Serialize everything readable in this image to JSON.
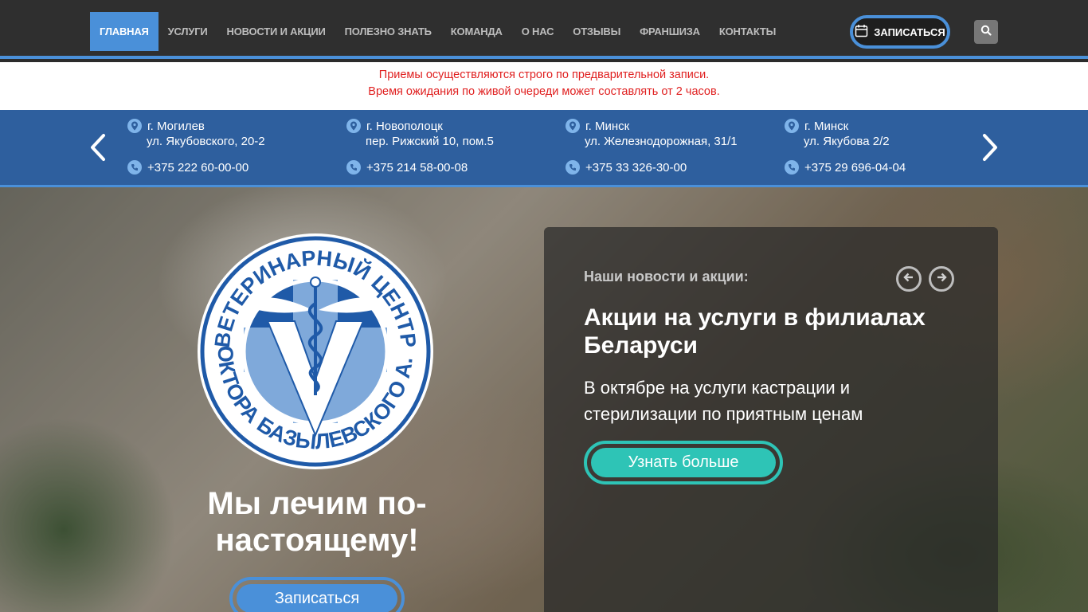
{
  "nav": {
    "items": [
      {
        "label": "ГЛАВНАЯ"
      },
      {
        "label": "УСЛУГИ"
      },
      {
        "label": "НОВОСТИ И АКЦИИ"
      },
      {
        "label": "ПОЛЕЗНО ЗНАТЬ"
      },
      {
        "label": "КОМАНДА"
      },
      {
        "label": "О НАС"
      },
      {
        "label": "ОТЗЫВЫ"
      },
      {
        "label": "ФРАНШИЗА"
      },
      {
        "label": "КОНТАКТЫ"
      }
    ],
    "book_label": "ЗАПИСАТЬСЯ"
  },
  "notice": {
    "line1": "Приемы осуществляются строго по предварительной записи.",
    "line2": "Время ожидания по живой очереди может составлять от 2 часов."
  },
  "branches": [
    {
      "city": "г. Могилев",
      "street": "ул. Якубовского, 20-2",
      "phone": "+375 222 60-00-00"
    },
    {
      "city": "г. Новополоцк",
      "street": "пер. Рижский 10, пом.5",
      "phone": "+375 214 58-00-08"
    },
    {
      "city": "г. Минск",
      "street": "ул. Железнодорожная, 31/1",
      "phone": "+375 33 326-30-00"
    },
    {
      "city": "г. Минск",
      "street": "ул. Якубова 2/2",
      "phone": "+375 29 696-04-04"
    }
  ],
  "hero": {
    "logo_text_top": "ВЕТЕРИНАРНЫЙ ЦЕНТР",
    "logo_text_bottom": "ДОКТОРА БАЗЫЛЕВСКОГО А. А.",
    "slogan": "Мы лечим по-настоящему!",
    "cta_label": "Записаться"
  },
  "news": {
    "heading": "Наши новости и акции:",
    "title": "Акции на услуги в филиалах Беларуси",
    "text": "В октябре на услуги кастрации и стерилизации по приятным ценам",
    "more_label": "Узнать больше"
  },
  "colors": {
    "accent": "#4a90d9",
    "teal": "#2ec4b6",
    "notice_red": "#e02020",
    "strip_blue": "#2e5f9e"
  }
}
